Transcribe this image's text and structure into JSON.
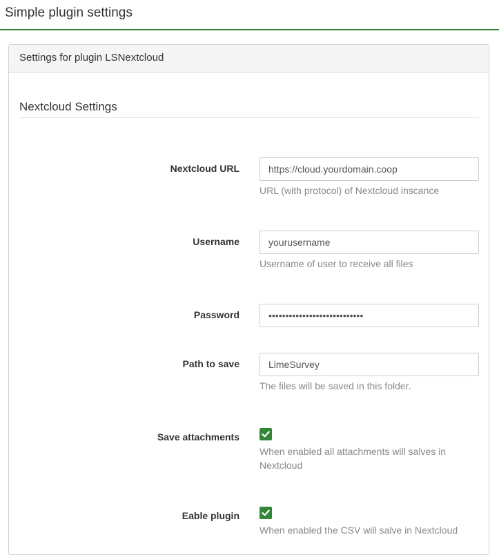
{
  "header": {
    "title": "Simple plugin settings"
  },
  "panel": {
    "title": "Settings for plugin LSNextcloud"
  },
  "section": {
    "title": "Nextcloud Settings"
  },
  "fields": {
    "url": {
      "label": "Nextcloud URL",
      "value": "https://cloud.yourdomain.coop",
      "help": "URL (with protocol) of Nextcloud inscance"
    },
    "username": {
      "label": "Username",
      "value": "yourusername",
      "help": "Username of user to receive all files"
    },
    "password": {
      "label": "Password",
      "value": "yourpasswordplaceholder12345"
    },
    "path": {
      "label": "Path to save",
      "value": "LimeSurvey",
      "help": "The files will be saved in this folder."
    },
    "save_attachments": {
      "label": "Save attachments",
      "checked": true,
      "help": "When enabled all attachments will salves in Nextcloud"
    },
    "enable_plugin": {
      "label": "Eable plugin",
      "checked": true,
      "help": "When enabled the CSV will salve in Nextcloud"
    }
  },
  "colors": {
    "accent": "#328637",
    "help_text": "#888888",
    "panel_heading_bg": "#f5f5f5"
  }
}
